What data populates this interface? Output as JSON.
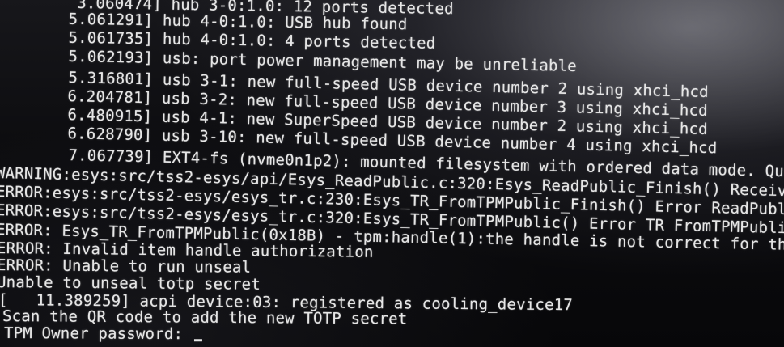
{
  "terminal": {
    "lines": [
      "     3.060474] hub 3-0:1.0: 12 ports detected",
      "    5.061291] hub 4-0:1.0: USB hub found",
      "    5.061735] hub 4-0:1.0: 4 ports detected",
      "    5.062193] usb: port power management may be unreliable",
      "    5.316801] usb 3-1: new full-speed USB device number 2 using xhci_hcd",
      "    6.204781] usb 3-2: new full-speed USB device number 3 using xhci_hcd",
      "    6.480915] usb 4-1: new SuperSpeed USB device number 2 using xhci_hcd",
      "    6.628790] usb 3-10: new full-speed USB device number 4 using xhci_hcd",
      "    7.067739] EXT4-fs (nvme0n1p2): mounted filesystem with ordered data mode. Quota mode: n",
      "WARNING:esys:src/tss2-esys/api/Esys_ReadPublic.c:320:Esys_ReadPublic_Finish() Received TPM E",
      "ERROR:esys:src/tss2-esys/esys_tr.c:230:Esys_TR_FromTPMPublic_Finish() Error ReadPublic Error",
      "ERROR:esys:src/tss2-esys/esys_tr.c:320:Esys_TR_FromTPMPublic() Error TR FromTPMPublic ErrorC",
      "ERROR: Esys_TR_FromTPMPublic(0x18B) - tpm:handle(1):the handle is not correct for the use",
      "ERROR: Invalid item handle authorization",
      "ERROR: Unable to run unseal",
      "Unable to unseal totp secret",
      "[   11.389259] acpi device:03: registered as cooling_device17",
      "Scan the QR code to add the new TOTP secret",
      "TPM Owner password: "
    ]
  }
}
